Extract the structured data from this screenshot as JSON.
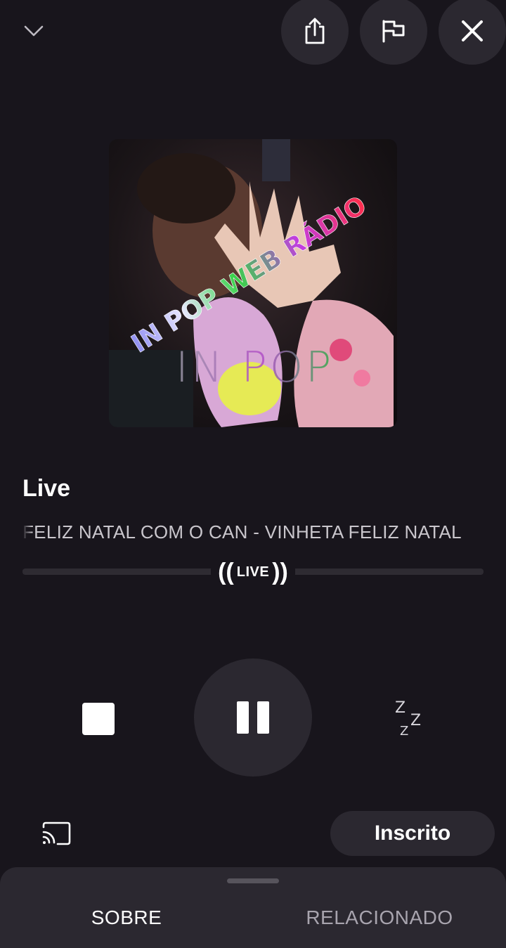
{
  "header": {
    "collapse_icon": "chevron-down-icon",
    "share_icon": "share-icon",
    "report_icon": "flag-icon",
    "close_icon": "close-icon"
  },
  "artwork": {
    "logo_text": "IN POP WEB RÁDIO",
    "watermark_text": "IN POP"
  },
  "now_playing": {
    "title": "Live",
    "subtitle": "FELIZ NATAL COM O CAN - VINHETA FELIZ NATAL",
    "live_badge": "LIVE"
  },
  "controls": {
    "stop_icon": "stop-icon",
    "pause_icon": "pause-icon",
    "sleep_timer_icon": "sleep-timer-icon",
    "sleep_timer_glyphs": [
      "Z",
      "Z",
      "Z"
    ]
  },
  "actions": {
    "cast_icon": "cast-icon",
    "subscribed_label": "Inscrito"
  },
  "bottom_sheet": {
    "tabs": [
      {
        "label": "SOBRE",
        "active": true
      },
      {
        "label": "RELACIONADO",
        "active": false
      }
    ]
  },
  "colors": {
    "background": "#18151c",
    "surface": "#2b2830",
    "text_primary": "#ffffff",
    "text_secondary": "#c9c6cc",
    "logo_gradient": [
      "#8f8cf0",
      "#e8e8ff",
      "#39d34a",
      "#c33de0",
      "#ff2e4a"
    ]
  }
}
